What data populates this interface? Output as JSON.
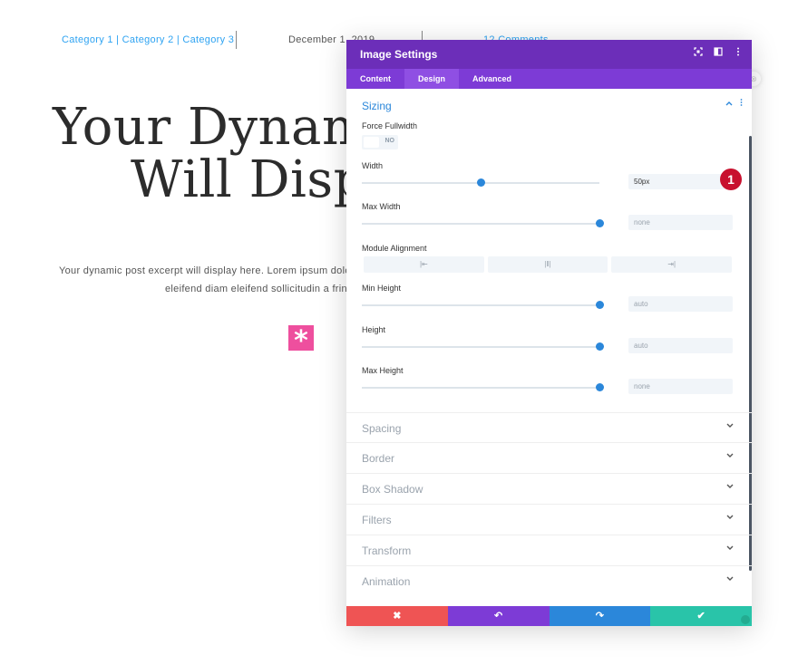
{
  "page": {
    "categories": "Category 1 | Category 2 | Category 3",
    "date": "December 1, 2019",
    "comments": "12 Comments",
    "title_line1": "Your Dynami",
    "title_line2": "Will Displ",
    "excerpt_line1": "Your dynamic post excerpt will display here. Lorem ipsum dolor si",
    "excerpt_line2": "eleifend diam eleifend sollicitudin a fring",
    "icon_glyph": "*"
  },
  "modal": {
    "title": "Image Settings",
    "header_icons": [
      "expand-icon",
      "split-view-icon",
      "more-icon"
    ],
    "tabs": [
      {
        "label": "Content",
        "active": false
      },
      {
        "label": "Design",
        "active": true
      },
      {
        "label": "Advanced",
        "active": false
      }
    ],
    "sizing": {
      "title": "Sizing",
      "force_fullwidth_label": "Force Fullwidth",
      "force_fullwidth_value": "NO",
      "width_label": "Width",
      "width_value": "50px",
      "width_fraction": 0.5,
      "max_width_label": "Max Width",
      "max_width_value": "none",
      "max_width_fraction": 1.0,
      "module_alignment_label": "Module Alignment",
      "alignment_options": [
        "left-align-icon",
        "center-align-icon",
        "right-align-icon"
      ],
      "min_height_label": "Min Height",
      "min_height_value": "auto",
      "min_height_fraction": 1.0,
      "height_label": "Height",
      "height_value": "auto",
      "height_fraction": 1.0,
      "max_height_label": "Max Height",
      "max_height_value": "none",
      "max_height_fraction": 1.0
    },
    "sections": [
      "Spacing",
      "Border",
      "Box Shadow",
      "Filters",
      "Transform",
      "Animation"
    ],
    "badge": "1",
    "footer": {
      "cancel_glyph": "✖",
      "undo_glyph": "↶",
      "redo_glyph": "↷",
      "save_glyph": "✔"
    },
    "colors": {
      "header": "#6c2eb9",
      "tabs": "#7d3bd6",
      "accent": "#2b87da",
      "cancel": "#ef5454",
      "undo": "#7d3bd6",
      "redo": "#2b87da",
      "save": "#29c4a9",
      "badge": "#c8102e"
    }
  }
}
